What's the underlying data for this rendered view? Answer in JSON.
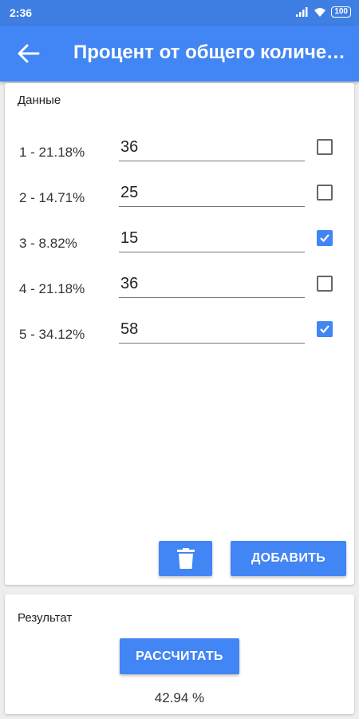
{
  "status": {
    "time": "2:36",
    "battery": "100"
  },
  "header": {
    "title": "Процент от общего количества"
  },
  "data_section": {
    "title": "Данные",
    "rows": [
      {
        "label": "1 - 21.18%",
        "value": "36",
        "checked": false
      },
      {
        "label": "2 - 14.71%",
        "value": "25",
        "checked": false
      },
      {
        "label": "3 - 8.82%",
        "value": "15",
        "checked": true
      },
      {
        "label": "4 - 21.18%",
        "value": "36",
        "checked": false
      },
      {
        "label": "5 - 34.12%",
        "value": "58",
        "checked": true
      }
    ],
    "add_label": "ДОБАВИТЬ"
  },
  "result_section": {
    "title": "Результат",
    "calc_label": "РАССЧИТАТЬ",
    "value": "42.94 %"
  },
  "colors": {
    "primary": "#4285f4",
    "status_bar": "#3f7ee3",
    "background": "#eeeeee"
  }
}
